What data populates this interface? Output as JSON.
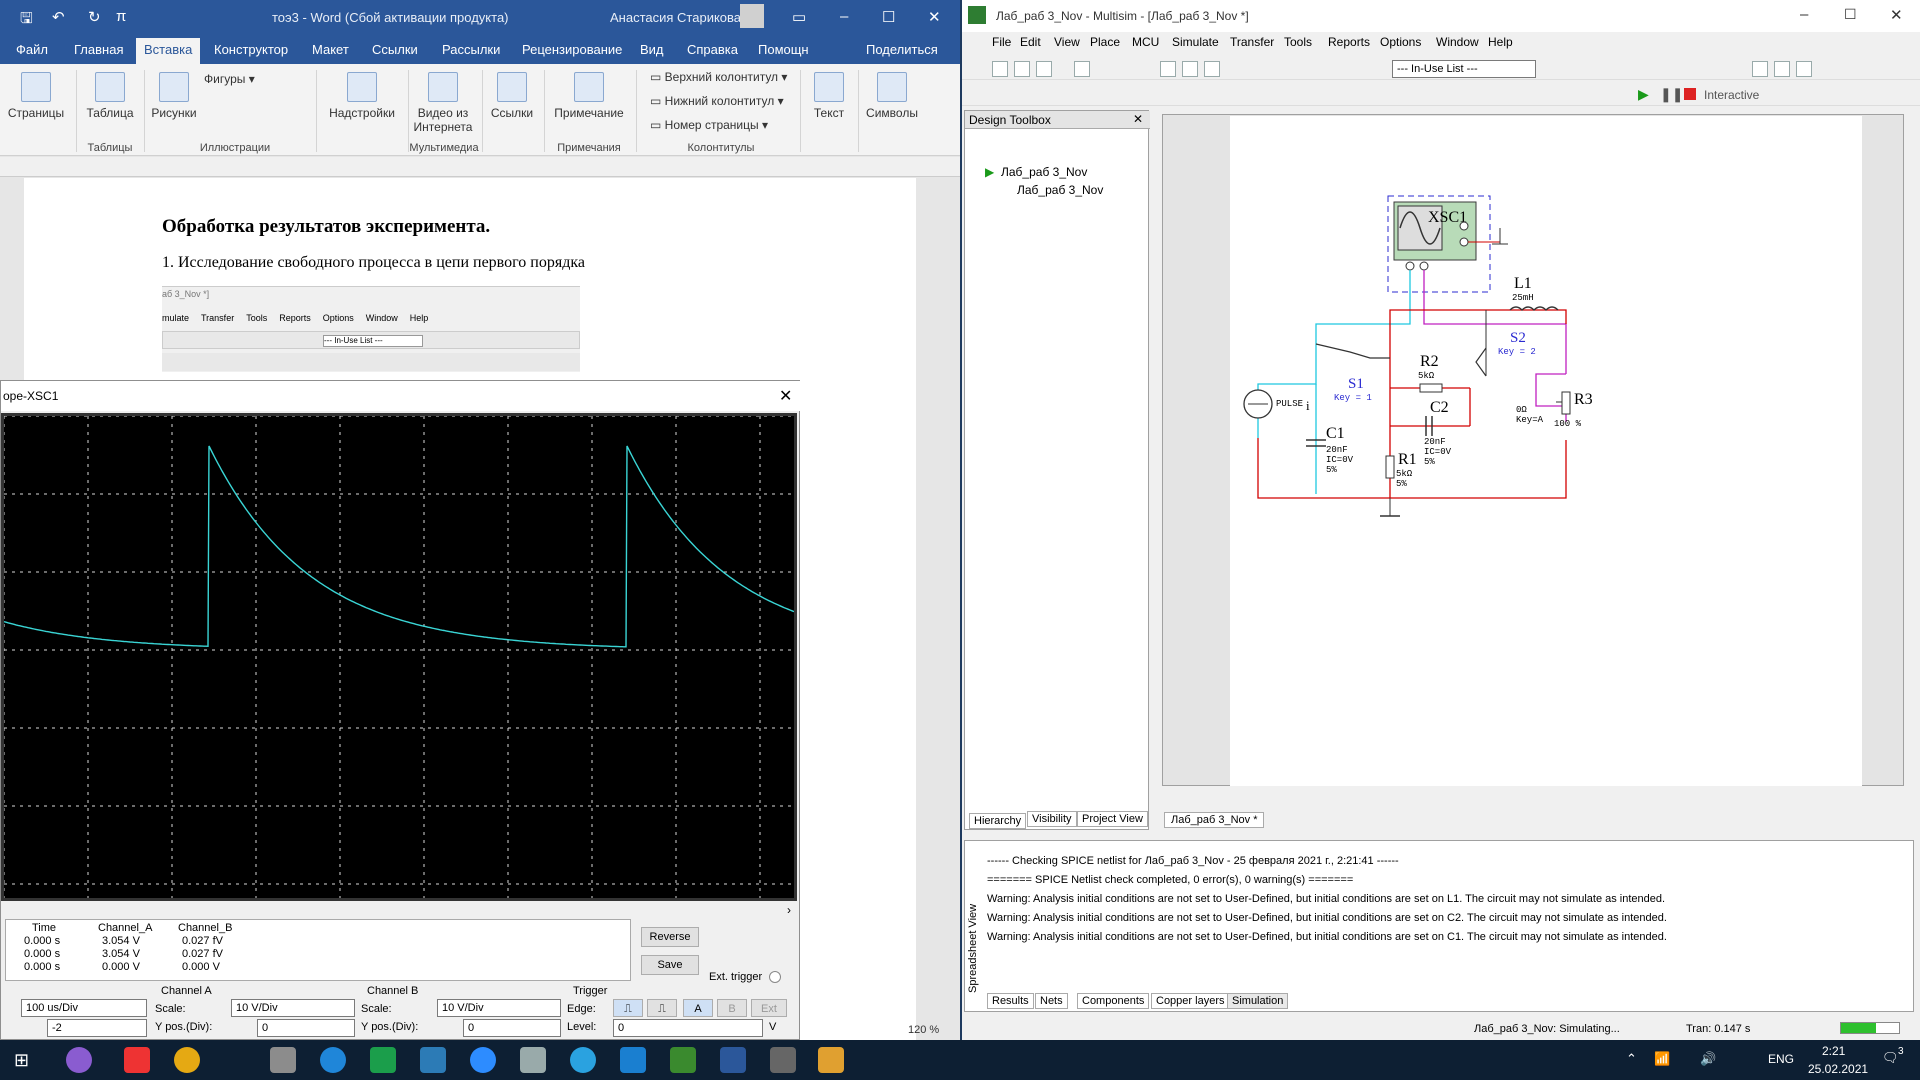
{
  "word": {
    "title": "тоэ3 - Word (Сбой активации продукта)",
    "user": "Анастасия Старикова",
    "tabs": [
      "Файл",
      "Главная",
      "Вставка",
      "Конструктор",
      "Макет",
      "Ссылки",
      "Рассылки",
      "Рецензирование",
      "Вид",
      "Справка",
      "Помощн",
      "Поделиться"
    ],
    "ribbon": {
      "pages": "Страницы",
      "table": "Таблица",
      "pictures": "Рисунки",
      "shapes": "Фигуры",
      "addins": "Надстройки",
      "video": "Видео из Интернета",
      "links": "Ссылки",
      "comment": "Примечание",
      "header": "Верхний колонтитул",
      "footer": "Нижний колонтитул",
      "pagenum": "Номер страницы",
      "text": "Текст",
      "symbols": "Символы",
      "groups": [
        "Таблицы",
        "Иллюстрации",
        "Мультимедиа",
        "Примечания",
        "Колонтитулы"
      ]
    },
    "doc": {
      "heading": "Обработка результатов эксперимента.",
      "item": "1.   Исследование свободного процесса в цепи первого порядка"
    },
    "embedded_menu": [
      "mulate",
      "Transfer",
      "Tools",
      "Reports",
      "Options",
      "Window",
      "Help"
    ],
    "embedded_title": "аб 3_Nov *]",
    "zoom": "120 %"
  },
  "scope": {
    "title": "ope-XSC1",
    "readout": {
      "headers": [
        "Time",
        "Channel_A",
        "Channel_B"
      ],
      "rows": [
        [
          "0.000 s",
          "3.054 V",
          "0.027 fV"
        ],
        [
          "0.000 s",
          "3.054 V",
          "0.027 fV"
        ],
        [
          "0.000 s",
          "0.000 V",
          "0.000 V"
        ]
      ]
    },
    "reverse": "Reverse",
    "save": "Save",
    "ext_trigger": "Ext. trigger",
    "timebase": "100 us/Div",
    "xpos": "-2",
    "channel_a": {
      "label": "Channel A",
      "scale_label": "Scale:",
      "scale": "10  V/Div",
      "ypos_label": "Y pos.(Div):",
      "ypos": "0"
    },
    "channel_b": {
      "label": "Channel B",
      "scale_label": "Scale:",
      "scale": "10  V/Div",
      "ypos_label": "Y pos.(Div):",
      "ypos": "0"
    },
    "trigger": {
      "label": "Trigger",
      "edge_label": "Edge:",
      "level_label": "Level:",
      "level": "0",
      "unit": "V",
      "a": "A",
      "b": "B",
      "ext": "Ext"
    },
    "trace_color": "#3ad5d5"
  },
  "multisim": {
    "title": "Лаб_раб 3_Nov - Multisim - [Лаб_раб 3_Nov *]",
    "menu": [
      "File",
      "Edit",
      "View",
      "Place",
      "MCU",
      "Simulate",
      "Transfer",
      "Tools",
      "Reports",
      "Options",
      "Window",
      "Help"
    ],
    "inuse": "--- In-Use List ---",
    "interactive": "Interactive",
    "toolbox_title": "Design Toolbox",
    "tree": [
      "Лаб_раб 3_Nov",
      "Лаб_раб 3_Nov"
    ],
    "toolbox_tabs": [
      "Hierarchy",
      "Visibility",
      "Project View"
    ],
    "sheet_tab": "Лаб_раб 3_Nov *",
    "log": [
      "------ Checking SPICE netlist for Лаб_раб 3_Nov - 25 февраля 2021 г., 2:21:41 ------",
      "======= SPICE Netlist check completed, 0 error(s), 0 warning(s) =======",
      "Warning: Analysis initial conditions are not set to User-Defined, but initial conditions are set on L1. The circuit may not simulate as intended.",
      "Warning: Analysis initial conditions are not set to User-Defined, but initial conditions are set on C2. The circuit may not simulate as intended.",
      "Warning: Analysis initial conditions are not set to User-Defined, but initial conditions are set on C1. The circuit may not simulate as intended."
    ],
    "spread_label": "Spreadsheet View",
    "bottom_tabs": [
      "Results",
      "Nets",
      "Components",
      "Copper layers",
      "Simulation"
    ],
    "status": "Лаб_раб 3_Nov: Simulating...",
    "tran": "Tran: 0.147 s",
    "circuit": {
      "xsc1": "XSC1",
      "l1": "L1",
      "l1_val": "25mH",
      "s1": "S1",
      "s1_key": "Key = 1",
      "s2": "S2",
      "s2_key": "Key = 2",
      "r2": "R2",
      "r2_val": "5kΩ",
      "c2": "C2",
      "c2_val": [
        "20nF",
        "IC=0V",
        "5%"
      ],
      "c1": "C1",
      "c1_val": [
        "20nF",
        "IC=0V",
        "5%"
      ],
      "r1": "R1",
      "r1_val": [
        "5kΩ",
        "5%"
      ],
      "r3": "R3",
      "r3_val": [
        "0Ω",
        "Key=A"
      ],
      "r3_pct": "100 %",
      "pulse": "PULSE",
      "i": "i"
    }
  },
  "taskbar": {
    "lang": "ENG",
    "time": "2:21",
    "date": "25.02.2021",
    "notif": "3"
  }
}
